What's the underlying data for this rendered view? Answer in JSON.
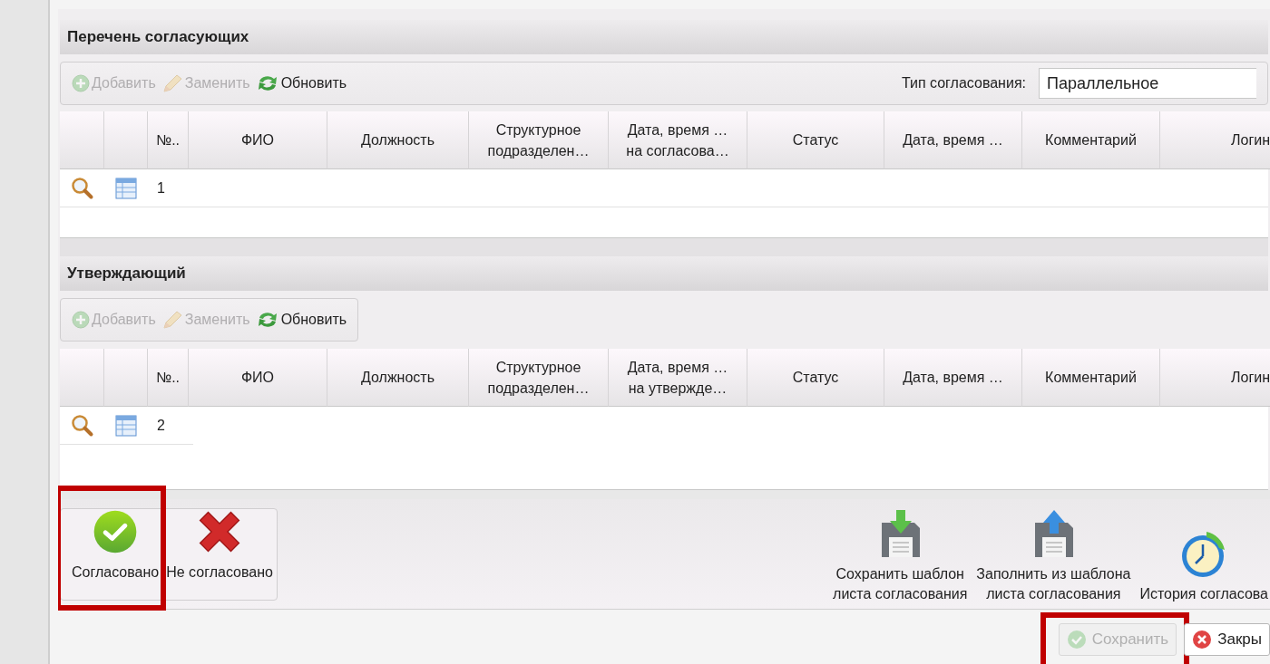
{
  "sections": [
    {
      "title": "Перечень согласующих",
      "toolbar": {
        "framed": false,
        "buttons": [
          {
            "label": "Добавить",
            "disabled": true
          },
          {
            "label": "Заменить",
            "disabled": true
          },
          {
            "label": "Обновить",
            "disabled": false
          }
        ],
        "approval_type": {
          "label": "Тип согласования:",
          "value": "Параллельное"
        }
      },
      "table": {
        "columns": [
          {},
          {},
          {
            "lines": [
              "№.."
            ]
          },
          {
            "lines": [
              "ФИО"
            ]
          },
          {
            "lines": [
              "Должность"
            ]
          },
          {
            "lines": [
              "Структурное",
              "подразделен…"
            ]
          },
          {
            "lines": [
              "Дата, время …",
              "на согласова…"
            ]
          },
          {
            "lines": [
              "Статус"
            ]
          },
          {
            "lines": [
              "Дата, время …"
            ]
          },
          {
            "lines": [
              "Комментарий"
            ]
          },
          {
            "lines": [
              "Логин"
            ]
          }
        ],
        "rows": [
          {
            "number": "1"
          }
        ]
      }
    },
    {
      "title": "Утверждающий",
      "toolbar": {
        "framed": true,
        "buttons": [
          {
            "label": "Добавить",
            "disabled": true
          },
          {
            "label": "Заменить",
            "disabled": true
          },
          {
            "label": "Обновить",
            "disabled": false
          }
        ]
      },
      "table": {
        "columns": [
          {},
          {},
          {
            "lines": [
              "№.."
            ]
          },
          {
            "lines": [
              "ФИО"
            ]
          },
          {
            "lines": [
              "Должность"
            ]
          },
          {
            "lines": [
              "Структурное",
              "подразделен…"
            ]
          },
          {
            "lines": [
              "Дата, время …",
              "на утвержде…"
            ]
          },
          {
            "lines": [
              "Статус"
            ]
          },
          {
            "lines": [
              "Дата, время …"
            ]
          },
          {
            "lines": [
              "Комментарий"
            ]
          },
          {
            "lines": [
              "Логин"
            ]
          }
        ],
        "rows": [
          {
            "number": "2"
          }
        ]
      }
    }
  ],
  "decision_buttons": [
    {
      "label": "Согласовано",
      "highlighted": true
    },
    {
      "label": "Не согласовано",
      "highlighted": false
    }
  ],
  "template_buttons": [
    {
      "lines": [
        "Сохранить шаблон",
        "листа согласования"
      ]
    },
    {
      "lines": [
        "Заполнить из шаблона",
        "листа согласования"
      ]
    },
    {
      "lines": [
        "История согласова"
      ]
    }
  ],
  "footer_buttons": [
    {
      "label": "Сохранить",
      "disabled": true,
      "highlighted": true
    },
    {
      "label": "Закры",
      "disabled": false,
      "highlighted": false
    }
  ]
}
